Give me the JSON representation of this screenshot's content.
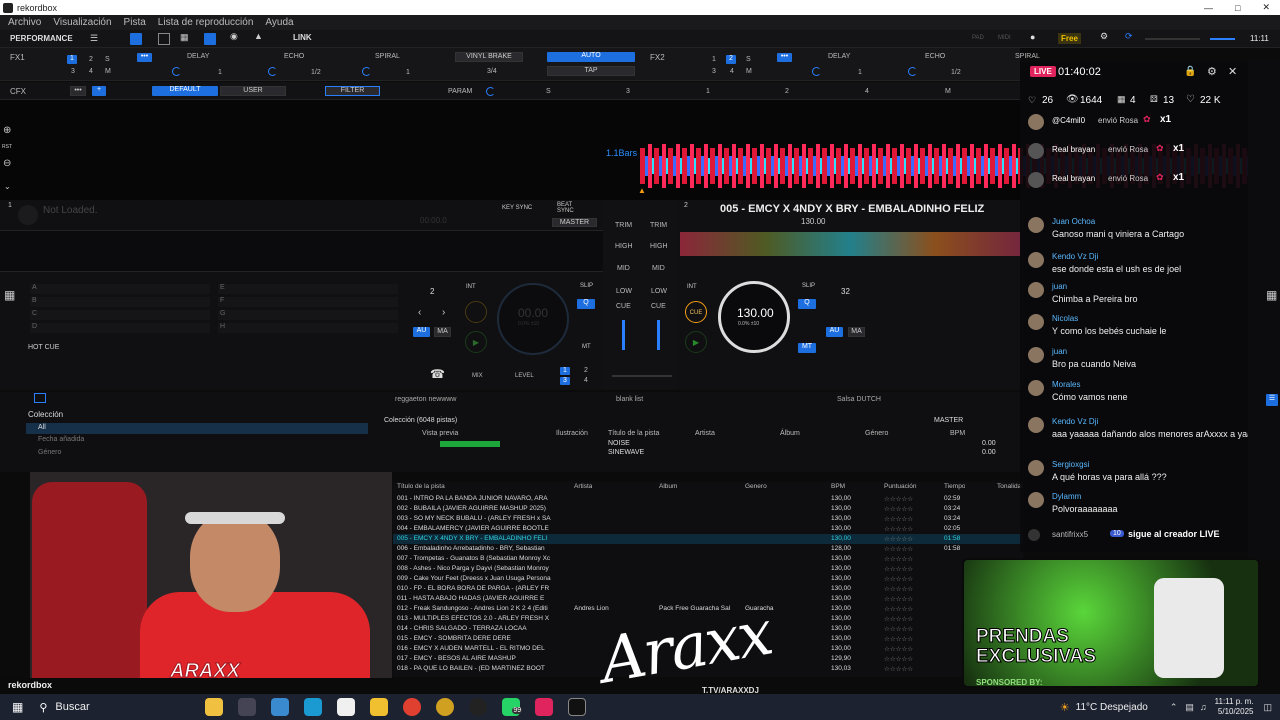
{
  "window": {
    "title": "rekordbox"
  },
  "menu": [
    "Archivo",
    "Visualización",
    "Pista",
    "Lista de reproducción",
    "Ayuda"
  ],
  "toolbar": {
    "mode": "PERFORMANCE",
    "link": "LINK",
    "free": "Free",
    "clock": "11:11",
    "pad": "PAD",
    "midi": "MIDI"
  },
  "fx1": {
    "label": "FX1",
    "effects": [
      "DELAY",
      "ECHO",
      "SPIRAL"
    ],
    "vinyl": "VINYL BRAKE",
    "auto": "AUTO",
    "tap": "TAP",
    "frac": "3/4",
    "vals": [
      "1",
      "1/2",
      "1"
    ],
    "nums": [
      "1",
      "2",
      "S",
      "3",
      "4",
      "M"
    ]
  },
  "fx2": {
    "label": "FX2",
    "effects": [
      "DELAY",
      "ECHO",
      "SPIRAL"
    ],
    "nums": [
      "1",
      "2",
      "S",
      "3",
      "4",
      "M"
    ],
    "vals": [
      "1",
      "1/2",
      "1"
    ]
  },
  "cfx": {
    "label": "CFX",
    "default": "DEFAULT",
    "user": "USER",
    "filter": "FILTER",
    "param": "PARAM",
    "s": "S",
    "knobs": [
      "3",
      "1",
      "2",
      "4",
      "M"
    ]
  },
  "wave": {
    "bars": "1.1Bars",
    "rst": "RST"
  },
  "deck1": {
    "num": "1",
    "status": "Not Loaded.",
    "time": "00:00.0",
    "remain": "00:00.0",
    "keysync": "KEY SYNC",
    "beatsync": "BEAT SYNC",
    "master": "MASTER",
    "bpm": "00.00",
    "pct": "0.0%  ±10",
    "hotcue": "HOT CUE",
    "pads": [
      "A",
      "B",
      "C",
      "D"
    ],
    "pads2": [
      "E",
      "F",
      "G",
      "H"
    ],
    "beat": "2",
    "int": "INT",
    "slip": "SLIP",
    "q": "Q",
    "au": "AU",
    "ma": "MA",
    "mt": "MT"
  },
  "deck2": {
    "num": "2",
    "title": "005 - EMCY X 4NDY X BRY - EMBALADINHO FELIZ",
    "bpm_small": "130.00",
    "keysync": "KEY SYNC",
    "beatsync": "BEAT SYNC",
    "master": "MASTER",
    "bpm": "130.00",
    "pct": "0.0%  ±10",
    "cue": "CUE",
    "int": "INT",
    "slip": "SLIP",
    "beat": "32",
    "q": "Q",
    "au": "AU",
    "ma": "MA",
    "mt": "MT",
    "hotcue": "HOT CUE",
    "time": "20"
  },
  "mixer": {
    "trim": "TRIM",
    "high": "HIGH",
    "mid": "MID",
    "low": "LOW",
    "cue": "CUE",
    "mix": "MIX",
    "level": "LEVEL",
    "ch": [
      "1",
      "2",
      "3",
      "4"
    ]
  },
  "browser": {
    "tree": [
      "Colección",
      "All",
      "Fecha añadida",
      "Género"
    ],
    "playlist1": "reggaeton newwww",
    "playlist2": "blank list",
    "playlist3": "Salsa DUTCH",
    "collection": "Colección (6048 pistas)",
    "master": "MASTER",
    "headers": [
      "Vista previa",
      "Ilustración",
      "Título de la pista",
      "Artista",
      "Álbum",
      "Género",
      "BPM",
      "Puntuación"
    ],
    "rows": [
      {
        "t": "NOISE",
        "bpm": "0.00"
      },
      {
        "t": "SINEWAVE",
        "bpm": "0.00"
      }
    ]
  },
  "tracklist": {
    "headers": [
      "Título de la pista",
      "Artista",
      "Álbum",
      "Genero",
      "BPM",
      "Puntuación",
      "Tiempo",
      "Tonalidad"
    ],
    "stars": "☆☆☆☆☆",
    "rows": [
      {
        "title": "001 - INTRO PA LA BANDA JUNIOR NAVARO, ARA",
        "artist": "",
        "album": "",
        "genre": "",
        "bpm": "130,00",
        "time": "02:59"
      },
      {
        "title": "002 - BUBAILA (JAVIER AGUIRRE MASHUP 2025)",
        "artist": "",
        "album": "",
        "genre": "",
        "bpm": "130,00",
        "time": "03:24"
      },
      {
        "title": "003 - SO MY NECK BUBALU - (ARLEY FRESH x SA",
        "artist": "",
        "album": "",
        "genre": "",
        "bpm": "130,00",
        "time": "03:24"
      },
      {
        "title": "004 - EMBALAMERCY (JAVIER AGUIRRE BOOTLE",
        "artist": "",
        "album": "",
        "genre": "",
        "bpm": "130,00",
        "time": "02:05"
      },
      {
        "title": "005 - EMCY X 4NDY X BRY - EMBALADINHO FELI",
        "artist": "",
        "album": "",
        "genre": "",
        "bpm": "130,00",
        "time": "01:58",
        "sel": true
      },
      {
        "title": "006 - Embaladinho Arrebatadinho - BRY, Sebastian",
        "artist": "",
        "album": "",
        "genre": "",
        "bpm": "128,00",
        "time": "01:58"
      },
      {
        "title": "007 - Trompetas - Guanatos B (Sebastian Monroy Xc",
        "artist": "",
        "album": "",
        "genre": "",
        "bpm": "130,00",
        "time": ""
      },
      {
        "title": "008 - Ashes - Nico Parga y Dayvi (Sebastian Monroy",
        "artist": "",
        "album": "",
        "genre": "",
        "bpm": "130,00",
        "time": ""
      },
      {
        "title": "009 - Cake Your Feet (Dreess x Juan Usuga Persona",
        "artist": "",
        "album": "",
        "genre": "",
        "bpm": "130,00",
        "time": ""
      },
      {
        "title": "010 - FP - EL BORA BORA DE PARGA - (ARLEY FR",
        "artist": "",
        "album": "",
        "genre": "",
        "bpm": "130,00",
        "time": ""
      },
      {
        "title": "011 - HASTA ABAJO HADAS (JAVIER AGUIRRE E",
        "artist": "",
        "album": "",
        "genre": "",
        "bpm": "130,00",
        "time": ""
      },
      {
        "title": "012 - Freak Sandungoso - Andres Lion 2 K 2 4 (Editi",
        "artist": "Andres Lion",
        "album": "Pack Free Guaracha Sal",
        "genre": "Guaracha",
        "bpm": "130,00",
        "time": ""
      },
      {
        "title": "013 - MULTIPLES EFECTOS 2.0 - ARLEY FRESH X",
        "artist": "",
        "album": "",
        "genre": "",
        "bpm": "130,00",
        "time": ""
      },
      {
        "title": "014 - CHRIS SALGADO - TERRAZA LOCAA",
        "artist": "",
        "album": "",
        "genre": "",
        "bpm": "130,00",
        "time": ""
      },
      {
        "title": "015 - EMCY - SOMBRITA DERE DERE",
        "artist": "",
        "album": "",
        "genre": "",
        "bpm": "130,00",
        "time": ""
      },
      {
        "title": "016 - EMCY X AUDEN MARTELL - EL RITMO DEL",
        "artist": "",
        "album": "",
        "genre": "",
        "bpm": "130,00",
        "time": ""
      },
      {
        "title": "017 - EMCY - BESOS AL AIRE MASHUP",
        "artist": "",
        "album": "",
        "genre": "",
        "bpm": "129,90",
        "time": ""
      },
      {
        "title": "018 - PA QUE LO BAILEN - (ED MARTINEZ BOOT",
        "artist": "",
        "album": "",
        "genre": "",
        "bpm": "130,03",
        "time": ""
      }
    ]
  },
  "live": {
    "badge": "LIVE",
    "timer": "01:40:02",
    "stats": {
      "a": "26",
      "viewers": "1644",
      "c": "4",
      "d": "13",
      "likes": "22 K"
    }
  },
  "gifts": [
    {
      "user": "@C4mil0",
      "text": "envió Rosa",
      "count": "x1"
    },
    {
      "user": "Real brayan",
      "text": "envió Rosa",
      "count": "x1"
    },
    {
      "user": "Real brayan",
      "text": "envió Rosa",
      "count": "x1"
    }
  ],
  "chat": [
    {
      "user": "Juan Ochoa",
      "text": "Ganoso mani q viniera a Cartago"
    },
    {
      "user": "Kendo Vz Dji",
      "text": "ese donde esta el ush es de joel"
    },
    {
      "user": "juan",
      "text": "Chimba a Pereira bro"
    },
    {
      "user": "Nicolas",
      "text": "Y como los bebés cuchaie le"
    },
    {
      "user": "juan",
      "text": "Bro pa cuando Neiva"
    },
    {
      "user": "Morales",
      "text": "Cómo vamos nene"
    },
    {
      "user": "Kendo Vz Dji",
      "text": "aaa yaaaaa dañando alos menores arAxxxx a yaaaa"
    },
    {
      "user": "Sergioxgsi",
      "text": "A qué horas va para allá ???"
    },
    {
      "user": "Dylamm",
      "text": "Polvoraaaaaaaa"
    }
  ],
  "follow": {
    "user": "santifrixx5",
    "badge": "10",
    "text": "sigue al creador LIVE"
  },
  "promo": {
    "line1": "PRENDAS",
    "line2": "EXCLUSIVAS",
    "sponsored": "SPONSORED BY:"
  },
  "streamer": {
    "logo": "Araxx",
    "url": "T.TV/ARAXXDJ",
    "brand": "rekordbox"
  },
  "taskbar": {
    "search": "Buscar",
    "weather": "11°C  Despejado",
    "time": "11:11 p. m.",
    "date": "5/10/2025",
    "badge": "99"
  }
}
